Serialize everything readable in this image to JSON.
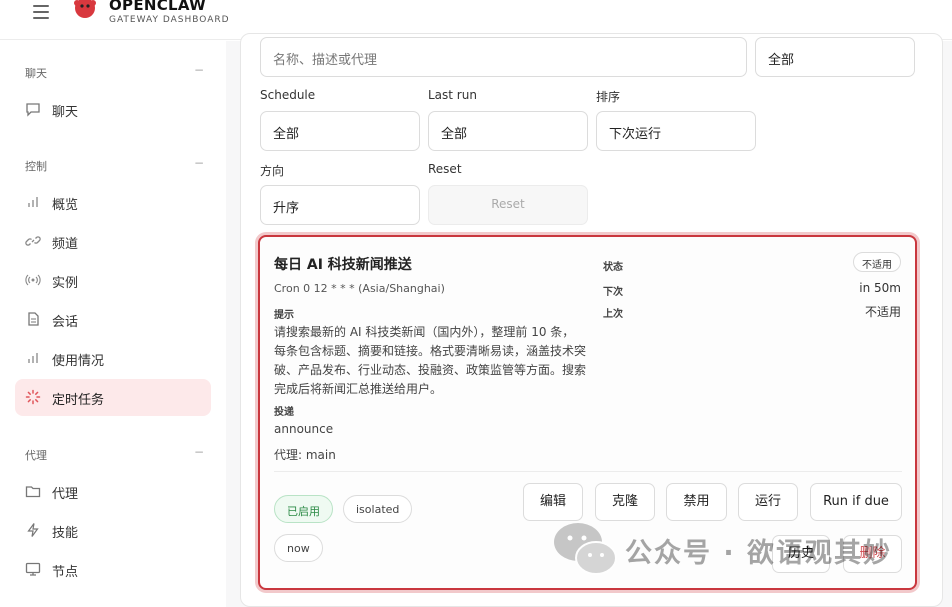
{
  "header": {
    "brand_title": "OPENCLAW",
    "brand_subtitle": "GATEWAY DASHBOARD"
  },
  "sidebar": {
    "groups": [
      {
        "title": "聊天",
        "toggle": "−",
        "items": [
          {
            "label": "聊天",
            "icon": "chat-icon"
          }
        ]
      },
      {
        "title": "控制",
        "toggle": "−",
        "items": [
          {
            "label": "概览",
            "icon": "bar-chart-icon"
          },
          {
            "label": "频道",
            "icon": "link-icon"
          },
          {
            "label": "实例",
            "icon": "broadcast-icon"
          },
          {
            "label": "会话",
            "icon": "document-icon"
          },
          {
            "label": "使用情况",
            "icon": "bar-chart-icon"
          },
          {
            "label": "定时任务",
            "icon": "loader-icon",
            "active": true
          }
        ]
      },
      {
        "title": "代理",
        "toggle": "−",
        "items": [
          {
            "label": "代理",
            "icon": "folder-icon"
          },
          {
            "label": "技能",
            "icon": "lightning-icon"
          },
          {
            "label": "节点",
            "icon": "monitor-icon"
          }
        ]
      }
    ]
  },
  "filters": {
    "search_placeholder": "名称、描述或代理",
    "enabled_select": "全部",
    "schedule_label": "Schedule",
    "schedule_value": "全部",
    "lastrun_label": "Last run",
    "lastrun_value": "全部",
    "sort_label": "排序",
    "sort_value": "下次运行",
    "direction_label": "方向",
    "direction_value": "升序",
    "reset_label": "Reset",
    "reset_button": "Reset"
  },
  "job": {
    "title": "每日 AI 科技新闻推送",
    "cron": "Cron 0 12 * * * (Asia/Shanghai)",
    "prompt_label": "提示",
    "prompt": "请搜索最新的 AI 科技类新闻（国内外），整理前 10 条，每条包含标题、摘要和链接。格式要清晰易读，涵盖技术突破、产品发布、行业动态、投融资、政策监管等方面。搜索完成后将新闻汇总推送给用户。",
    "delivery_label": "投递",
    "delivery_value": "announce",
    "agent_text": "代理: main",
    "status_key": "状态",
    "status_value": "不适用",
    "next_key": "下次",
    "next_value": "in 50m",
    "last_key": "上次",
    "last_value": "不适用",
    "chips": {
      "enabled": "已启用",
      "isolated": "isolated",
      "now": "now"
    },
    "actions": {
      "edit": "编辑",
      "clone": "克隆",
      "disable": "禁用",
      "run": "运行",
      "run_if_due": "Run if due",
      "history": "历史",
      "delete": "删除"
    }
  },
  "watermark": {
    "text": "公众号 · 欲语观其妙"
  }
}
